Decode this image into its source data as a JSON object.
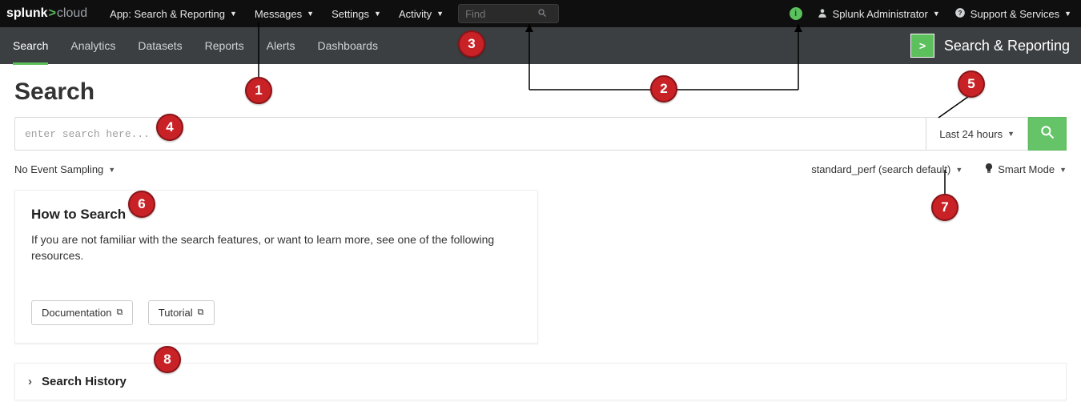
{
  "brand": {
    "left": "splunk",
    "chev": ">",
    "right": "cloud"
  },
  "topmenu": {
    "app": "App: Search & Reporting",
    "messages": "Messages",
    "settings": "Settings",
    "activity": "Activity"
  },
  "find": {
    "placeholder": "Find"
  },
  "topright": {
    "user": "Splunk Administrator",
    "support": "Support & Services"
  },
  "nav": {
    "items": [
      "Search",
      "Analytics",
      "Datasets",
      "Reports",
      "Alerts",
      "Dashboards"
    ],
    "app_title": "Search & Reporting",
    "logo_glyph": ">"
  },
  "page": {
    "title": "Search"
  },
  "search": {
    "placeholder": "enter search here...",
    "time_range": "Last 24 hours"
  },
  "subbar": {
    "sampling": "No Event Sampling",
    "workload": "standard_perf (search default)",
    "mode": "Smart Mode"
  },
  "howto": {
    "title": "How to Search",
    "body": "If you are not familiar with the search features, or want to learn more, see one of the following resources.",
    "doc_btn": "Documentation",
    "tut_btn": "Tutorial"
  },
  "history": {
    "label": "Search History"
  },
  "annotations": {
    "1": "1",
    "2": "2",
    "3": "3",
    "4": "4",
    "5": "5",
    "6": "6",
    "7": "7",
    "8": "8"
  }
}
